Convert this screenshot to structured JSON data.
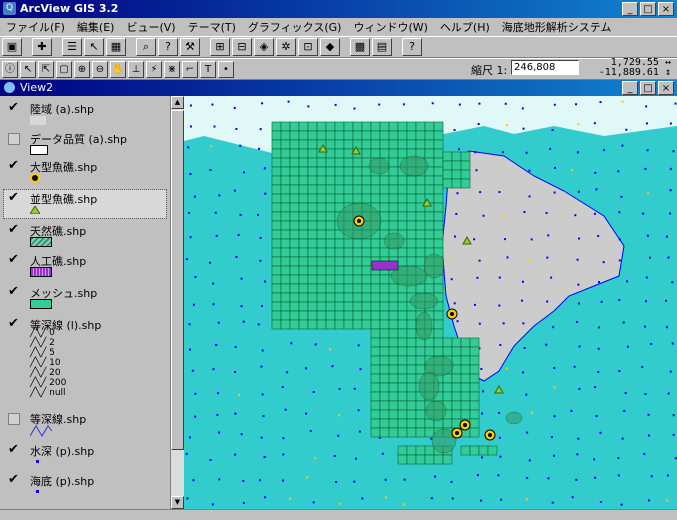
{
  "app": {
    "title": "ArcView GIS 3.2",
    "window_buttons": [
      "_",
      "□",
      "×"
    ]
  },
  "menu": [
    "ファイル(F)",
    "編集(E)",
    "ビュー(V)",
    "テーマ(T)",
    "グラフィックス(G)",
    "ウィンドウ(W)",
    "ヘルプ(H)",
    "海底地形解析システム"
  ],
  "toolbar": {
    "scale_label": "縮尺 1:",
    "scale_value": "246,808",
    "coord_x": "1,729.55 ↔",
    "coord_y": "-11,889.61 ↕"
  },
  "view": {
    "title": "View2",
    "window_buttons": [
      "_",
      "□",
      "×"
    ]
  },
  "layers": [
    {
      "name": "陸域 (a).shp",
      "checked": true,
      "swatch": "land"
    },
    {
      "name": "データ品質 (a).shp",
      "checked": false,
      "swatch": "rect-white"
    },
    {
      "name": "大型魚礁.shp",
      "checked": true,
      "swatch": "circle"
    },
    {
      "name": "並型魚礁.shp",
      "checked": true,
      "swatch": "triangle"
    },
    {
      "name": "天然礁.shp",
      "checked": true,
      "swatch": "hatch"
    },
    {
      "name": "人工礁.shp",
      "checked": true,
      "swatch": "purple"
    },
    {
      "name": "メッシュ.shp",
      "checked": true,
      "swatch": "mesh"
    },
    {
      "name": "等深線 (l).shp",
      "checked": true,
      "swatch": "contours"
    },
    {
      "name": "等深線.shp",
      "checked": false,
      "swatch": "zigzag"
    },
    {
      "name": "水深 (p).shp",
      "checked": true,
      "swatch": "dot"
    },
    {
      "name": "海底 (p).shp",
      "checked": true,
      "swatch": "dot"
    }
  ],
  "contour_values": [
    "0",
    "2",
    "5",
    "10",
    "20",
    "200",
    "null"
  ],
  "colors": {
    "sea": "#33cccc",
    "land": "#cccccc",
    "mesh": "#33cc99",
    "reef": "#339966",
    "depth_dot": "#0000ff",
    "fish_reef": "#ffcc00",
    "artificial": "#9933cc"
  }
}
